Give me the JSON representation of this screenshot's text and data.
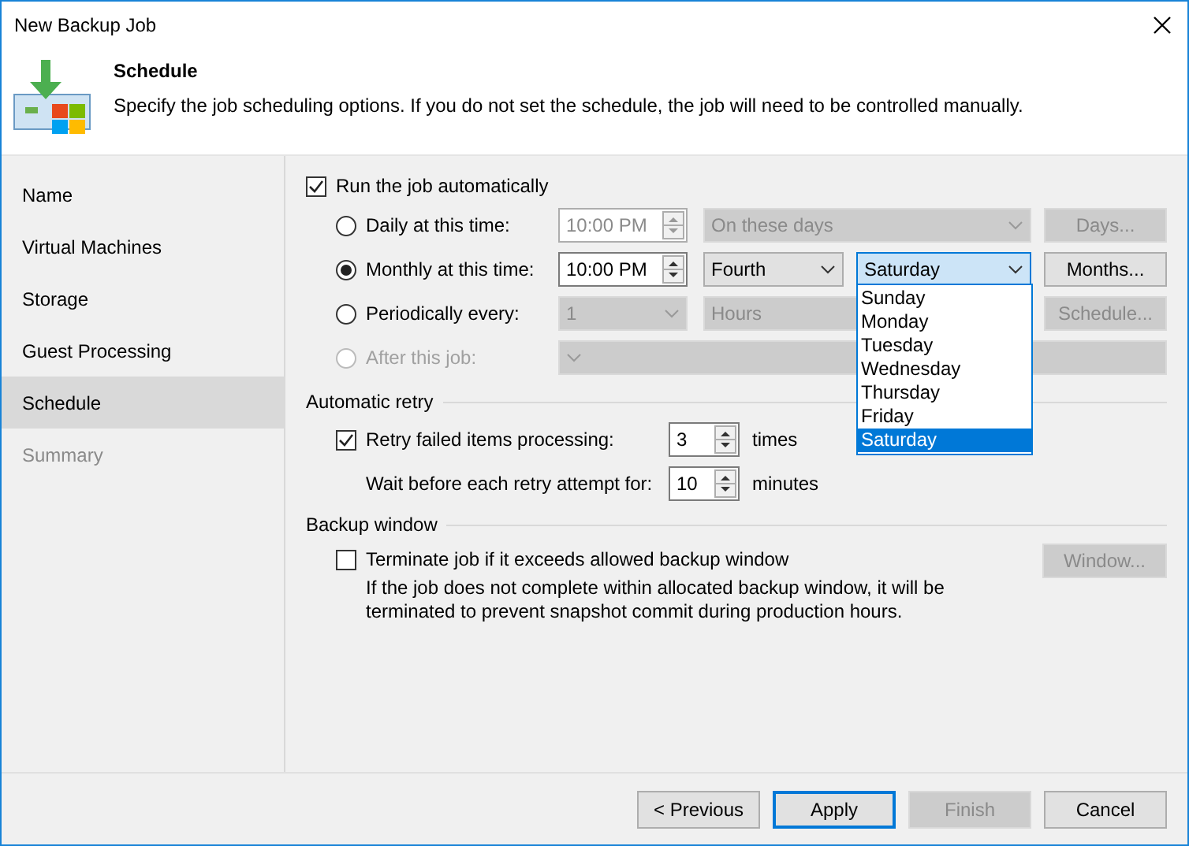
{
  "window": {
    "title": "New Backup Job"
  },
  "header": {
    "title": "Schedule",
    "description": "Specify the job scheduling options. If you do not set the schedule, the job will need to be controlled manually."
  },
  "steps": [
    {
      "label": "Name",
      "selected": false,
      "disabled": false
    },
    {
      "label": "Virtual Machines",
      "selected": false,
      "disabled": false
    },
    {
      "label": "Storage",
      "selected": false,
      "disabled": false
    },
    {
      "label": "Guest Processing",
      "selected": false,
      "disabled": false
    },
    {
      "label": "Schedule",
      "selected": true,
      "disabled": false
    },
    {
      "label": "Summary",
      "selected": false,
      "disabled": true
    }
  ],
  "run_automatically": {
    "label": "Run the job automatically",
    "checked": true
  },
  "schedule_options": [
    {
      "kind": "daily",
      "label": "Daily at this time:",
      "selected": false,
      "disabled": false,
      "time": "10:00 PM",
      "dropdown": "On these days",
      "button": "Days..."
    },
    {
      "kind": "monthly",
      "label": "Monthly at this time:",
      "selected": true,
      "disabled": false,
      "time": "10:00 PM",
      "dropdown": "Fourth",
      "dropdown_2": "Saturday",
      "button": "Months..."
    },
    {
      "kind": "periodic",
      "label": "Periodically every:",
      "selected": false,
      "disabled": false,
      "number": "1",
      "unit": "Hours",
      "button": "Schedule..."
    },
    {
      "kind": "after",
      "label": "After this job:",
      "selected": false,
      "disabled": true
    }
  ],
  "day_list": [
    {
      "label": "Sunday",
      "selected": false
    },
    {
      "label": "Monday",
      "selected": false
    },
    {
      "label": "Tuesday",
      "selected": false
    },
    {
      "label": "Wednesday",
      "selected": false
    },
    {
      "label": "Thursday",
      "selected": false
    },
    {
      "label": "Friday",
      "selected": false
    },
    {
      "label": "Saturday",
      "selected": true
    }
  ],
  "automatic_retry": {
    "heading": "Automatic retry",
    "retry": {
      "label": "Retry failed items processing:",
      "checked": true,
      "value": "3",
      "unit": "times"
    },
    "wait": {
      "label": "Wait before each retry attempt for:",
      "value": "10",
      "unit": "minutes"
    }
  },
  "backup_window": {
    "heading": "Backup window",
    "terminate": {
      "label": "Terminate job if it exceeds allowed backup window",
      "checked": false
    },
    "description": "If the job does not complete within allocated backup window, it will be terminated to prevent snapshot commit during production hours.",
    "button": "Window..."
  },
  "buttons": [
    {
      "label": "< Previous",
      "disabled": false,
      "default": false
    },
    {
      "label": "Apply",
      "disabled": false,
      "default": true
    },
    {
      "label": "Finish",
      "disabled": true,
      "default": false
    },
    {
      "label": "Cancel",
      "disabled": false,
      "default": false
    }
  ]
}
